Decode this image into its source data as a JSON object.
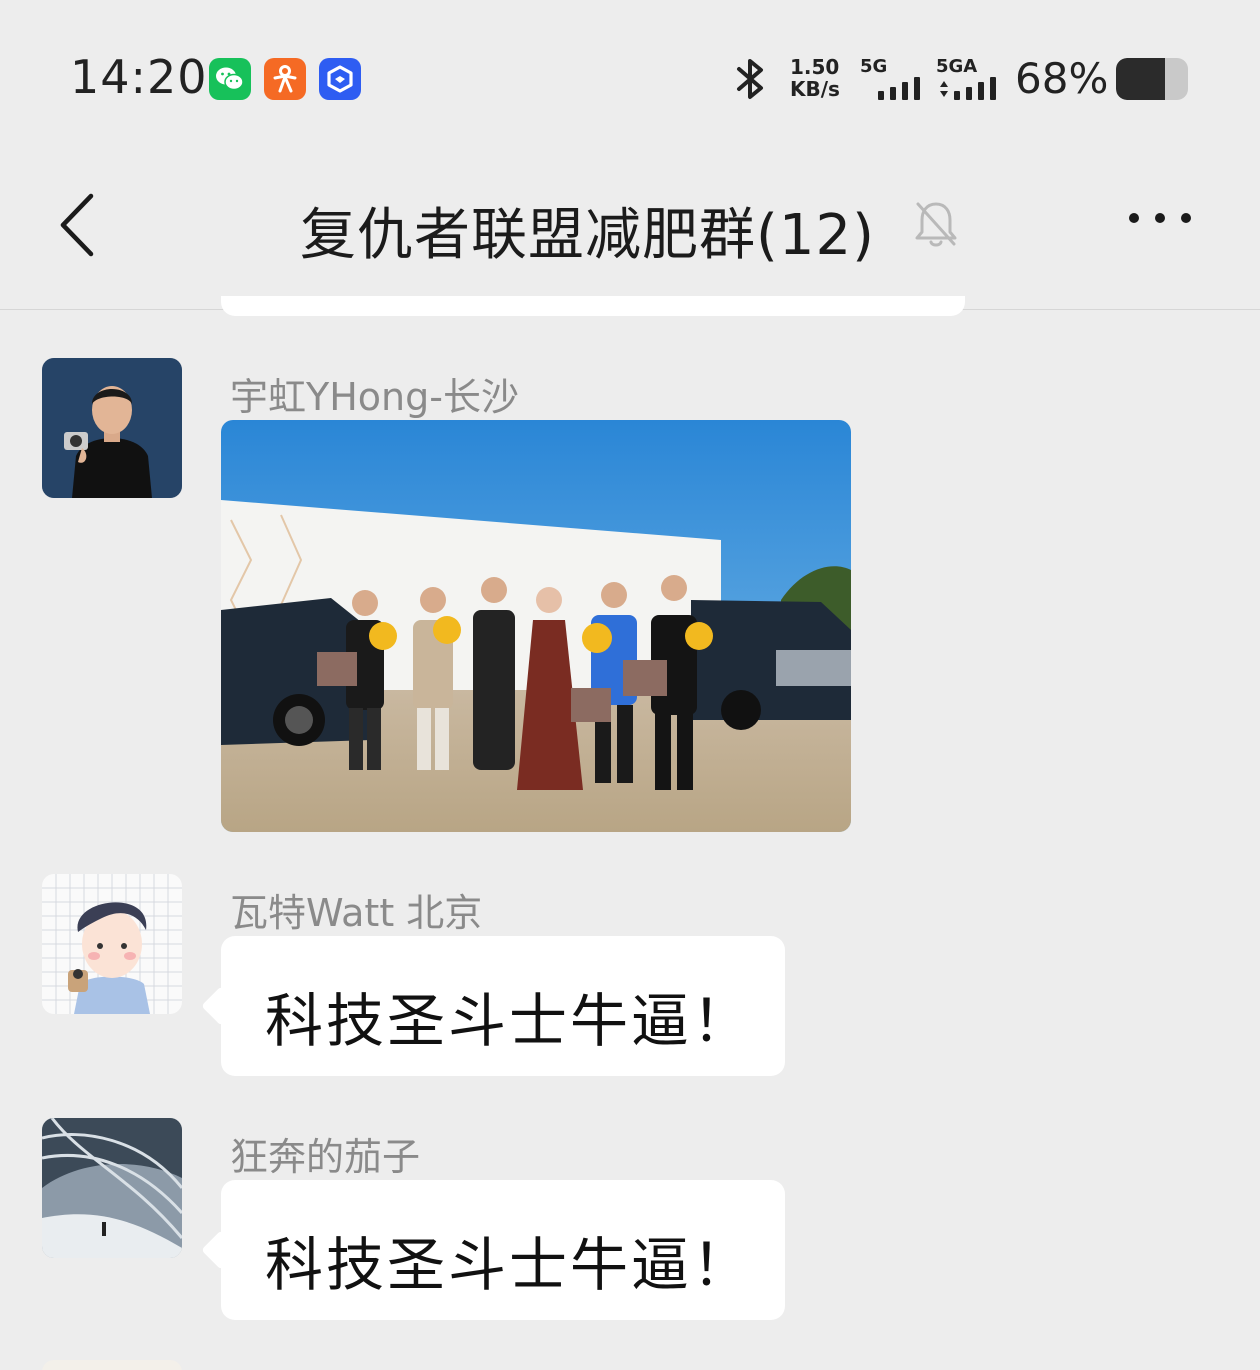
{
  "status_bar": {
    "time": "14:20",
    "notification_icons": [
      "wechat-icon",
      "people-app-icon",
      "blue-app-icon"
    ],
    "network_speed_value": "1.50",
    "network_speed_unit": "KB/s",
    "signal1_label": "5G",
    "signal2_label": "5GA",
    "battery_percent": "68%",
    "battery_level": 0.68
  },
  "navbar": {
    "title": "复仇者联盟减肥群(12)",
    "muted": true
  },
  "messages": [
    {
      "sender": "宇虹YHong-长沙",
      "type": "image",
      "avatar": "man-with-camera-avatar",
      "image": "car-delivery-group-photo"
    },
    {
      "sender": "瓦特Watt 北京",
      "type": "text",
      "text": "科技圣斗士牛逼！",
      "avatar": "cartoon-boy-avatar"
    },
    {
      "sender": "狂奔的茄子",
      "type": "text",
      "text": "科技圣斗士牛逼！",
      "avatar": "architecture-photo-avatar"
    }
  ],
  "colors": {
    "background": "#ededed",
    "bubble": "#ffffff",
    "sender_name": "#8a8a8a",
    "wechat_green": "#17c15a"
  }
}
